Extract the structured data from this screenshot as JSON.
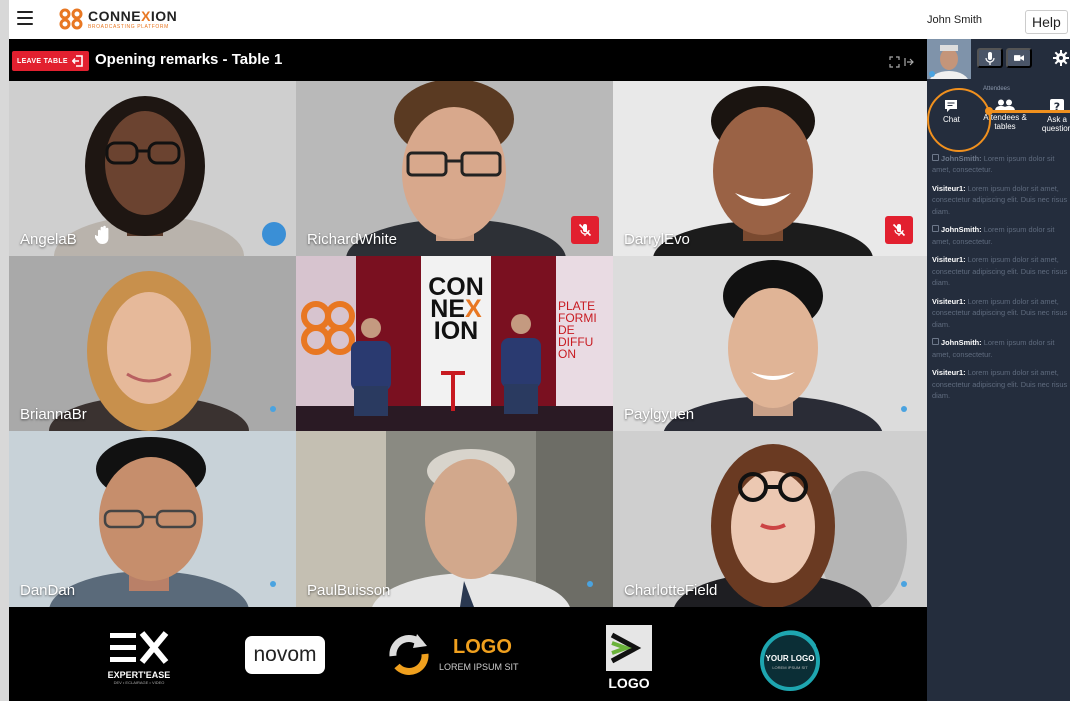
{
  "app": {
    "brand_name_pre": "CONNE",
    "brand_name_x": "X",
    "brand_name_post": "ION",
    "brand_tagline": "BROADCASTING PLATFORM",
    "user_name": "John Smith",
    "help_label": "Help"
  },
  "header": {
    "leave_label": "LEAVE TABLE",
    "title": "Opening remarks - Table 1"
  },
  "participants": [
    {
      "name": "AngelaB",
      "status": "hand-raised"
    },
    {
      "name": "RichardWhite",
      "status": "muted"
    },
    {
      "name": "DarrylEvo",
      "status": "muted"
    },
    {
      "name": "BriannaBr",
      "status": "active"
    },
    {
      "name": "",
      "status": "stage"
    },
    {
      "name": "Paylgyuen",
      "status": "active"
    },
    {
      "name": "DanDan",
      "status": "active"
    },
    {
      "name": "PaulBuisson",
      "status": "active"
    },
    {
      "name": "CharlotteField",
      "status": "active"
    }
  ],
  "stage": {
    "screen_line1": "CON",
    "screen_line2a": "NE",
    "screen_line2b": "X",
    "screen_line3": "ION",
    "side_text": [
      "PLATE",
      "FORMI",
      "DE",
      "DIFFU",
      "ON"
    ]
  },
  "sponsors": {
    "expertease_main": "EXPERT'EASE",
    "expertease_sub": "DEV • ECLAIRAGE • VIDEO",
    "novom": "novom",
    "logo1_main": "LOGO",
    "logo1_sub": "LOREM IPSUM SIT",
    "logo2_main": "LOGO",
    "yourlogo_main": "YOUR LOGO",
    "yourlogo_sub": "LOREM IPSUM SIT"
  },
  "panel": {
    "attendees_header": "Attendees",
    "tabs": [
      {
        "label": "Chat"
      },
      {
        "label": "Attendees & tables"
      },
      {
        "label": "Ask a question"
      }
    ],
    "messages": [
      {
        "author": "JohnSmith:",
        "text": "Lorem ipsum dolor sit amet, consectetur.",
        "dim": true,
        "lock": true
      },
      {
        "author": "Visiteur1:",
        "text": "Lorem ipsum dolor sit amet, consectetur adipiscing elit. Duis nec risus diam.",
        "dim": false,
        "lock": false
      },
      {
        "author": "JohnSmith:",
        "text": "Lorem ipsum dolor sit amet, consectetur.",
        "dim": false,
        "lock": true
      },
      {
        "author": "Visiteur1:",
        "text": "Lorem ipsum dolor sit amet, consectetur adipiscing elit. Duis nec risus diam.",
        "dim": false,
        "lock": false
      },
      {
        "author": "Visiteur1:",
        "text": "Lorem ipsum dolor sit amet, consectetur adipiscing elit. Duis nec risus diam.",
        "dim": false,
        "lock": false
      },
      {
        "author": "JohnSmith:",
        "text": "Lorem ipsum dolor sit amet, consectetur.",
        "dim": false,
        "lock": true
      },
      {
        "author": "Visiteur1:",
        "text": "Lorem ipsum dolor sit amet, consectetur adipiscing elit. Duis nec risus diam.",
        "dim": false,
        "lock": false
      }
    ]
  },
  "colors": {
    "accent": "#e87722",
    "danger": "#e2202f",
    "panel_bg": "#242d3d",
    "highlight": "#f0901e"
  }
}
